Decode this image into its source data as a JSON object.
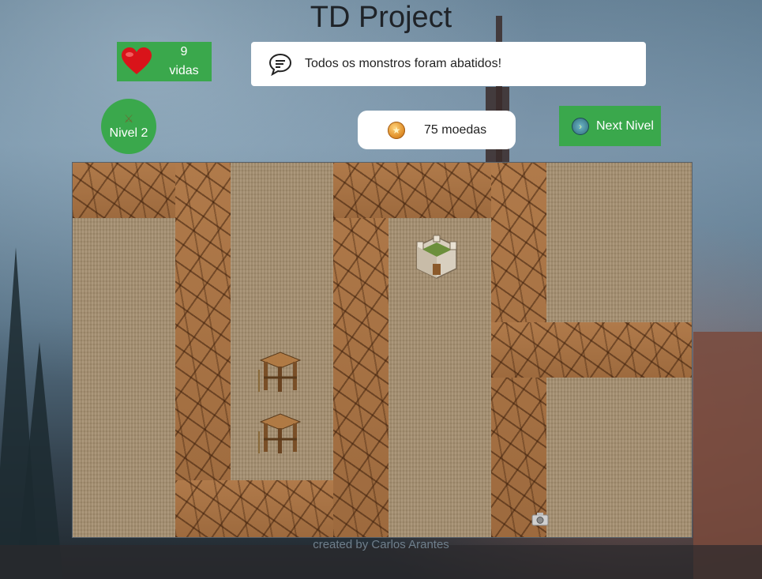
{
  "header": {
    "title": "TD Project"
  },
  "lives": {
    "count": "9",
    "label": "vidas",
    "icon": "heart-icon"
  },
  "message": {
    "text": "Todos os monstros foram abatidos!",
    "icon": "chat-icon"
  },
  "level": {
    "label": "Nivel 2",
    "icon": "swords-icon"
  },
  "coins": {
    "label": "75 moedas",
    "icon": "coin-icon"
  },
  "next_button": {
    "label": "Next Nivel",
    "icon": "arrow-right-icon"
  },
  "board": {
    "towers": [
      {
        "type": "castle-tower"
      },
      {
        "type": "wooden-tower"
      },
      {
        "type": "wooden-tower"
      }
    ]
  },
  "footer": {
    "credit": "created by Carlos Arantes"
  },
  "colors": {
    "accent_green": "#3aa84c",
    "title": "#1f2328",
    "path": "#a66f42",
    "grass": "#a48e6e"
  }
}
